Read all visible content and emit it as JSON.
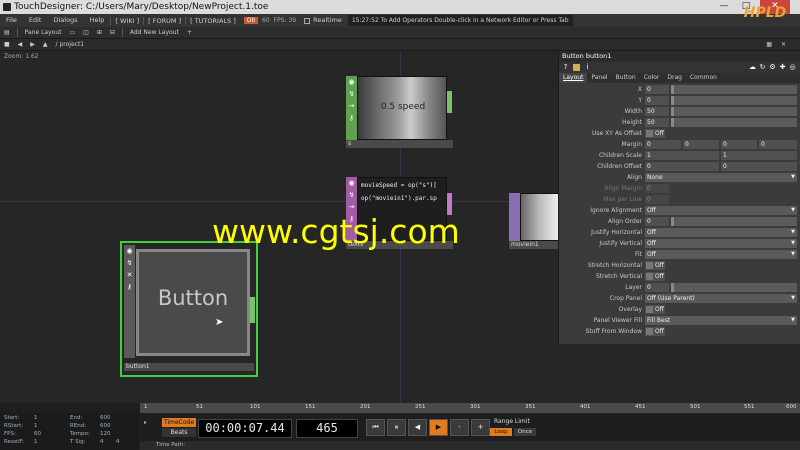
{
  "window": {
    "title": "TouchDesigner: C:/Users/Mary/Desktop/NewProject.1.toe",
    "minimize": "—",
    "maximize": "□",
    "close": "✕"
  },
  "menu": {
    "items": [
      "File",
      "Edit",
      "Dialogs",
      "Help"
    ],
    "links": [
      "[ WIKI ]",
      "[ FORUM ]",
      "[ TUTORIALS ]"
    ],
    "badge": "OII",
    "fps_label": "60",
    "fps_value": "FPS: 39",
    "realtime_label": "Realtime",
    "status": "15:27:52 To Add Operators Double-click in a Network Editor or Press Tab"
  },
  "toolbar": {
    "pane_layout": "Pane Layout",
    "add_new_layout": "Add New Layout",
    "plus": "+",
    "path": "/ project1"
  },
  "network": {
    "zoom": "Zoom: 1.62",
    "nodes": {
      "speed": {
        "label": "0.5 speed",
        "name": "s"
      },
      "text": {
        "line1": "movieSpeed = op(\"s\")[",
        "line2": "op(\"moviein1\").par.sp",
        "name": "text1"
      },
      "movie": {
        "name": "moviein1"
      },
      "button": {
        "label": "Button",
        "name": "button1"
      }
    }
  },
  "watermark": "www.cgtsj.com",
  "logo": "HPLD",
  "params": {
    "header": "Button   button1",
    "icons": [
      "?",
      "i"
    ],
    "tabs": [
      "Layout",
      "Panel",
      "Button",
      "Color",
      "Drag",
      "Common"
    ],
    "rows": [
      {
        "label": "X",
        "value": "0"
      },
      {
        "label": "Y",
        "value": "0"
      },
      {
        "label": "Width",
        "value": "50"
      },
      {
        "label": "Height",
        "value": "50"
      },
      {
        "label": "Use XY As Offset",
        "toggle": "Off"
      },
      {
        "label": "Margin",
        "values": [
          "0",
          "0",
          "0",
          "0"
        ]
      },
      {
        "label": "Children Scale",
        "values": [
          "1",
          "1"
        ]
      },
      {
        "label": "Children Offset",
        "values": [
          "0",
          "0"
        ]
      },
      {
        "label": "Align",
        "menu": "None"
      },
      {
        "label": "Align Margin",
        "value": "0"
      },
      {
        "label": "Max per Line",
        "value": "0"
      },
      {
        "label": "Ignore Alignment",
        "menu": "Off"
      },
      {
        "label": "Align Order",
        "value": "0"
      },
      {
        "label": "Justify Horizontal",
        "menu": "Off"
      },
      {
        "label": "Justify Vertical",
        "menu": "Off"
      },
      {
        "label": "Fit",
        "menu": "Off"
      },
      {
        "label": "Stretch Horizontal",
        "toggle": "Off"
      },
      {
        "label": "Stretch Vertical",
        "toggle": "Off"
      },
      {
        "label": "Layer",
        "value": "0"
      },
      {
        "label": "Crop Panel",
        "menu": "Off (Use Parent)"
      },
      {
        "label": "Overlay",
        "toggle": "Off"
      },
      {
        "label": "Panel Viewer Fill",
        "menu": "Fill Best"
      },
      {
        "label": "Stuff From Window",
        "toggle": "Off"
      }
    ]
  },
  "timeline": {
    "ticks": [
      "1",
      "51",
      "101",
      "151",
      "201",
      "251",
      "301",
      "351",
      "401",
      "451",
      "501",
      "551",
      "600"
    ],
    "stats": {
      "start_label": "Start:",
      "start": "1",
      "end_label": "End:",
      "end": "600",
      "rstart_label": "RStart:",
      "rstart": "1",
      "rend_label": "REnd:",
      "rend": "600",
      "fps_label": "FPS:",
      "fps": "60",
      "tempo_label": "Tempo:",
      "tempo": "120",
      "reset_label": "ResetF:",
      "reset": "1",
      "tsig_label": "T Sig:",
      "tsig_a": "4",
      "tsig_b": "4"
    },
    "timecode_tab": "TimeCode",
    "beats_tab": "Beats",
    "timecode": "00:00:07.44",
    "frame": "465",
    "transport": [
      "⏮",
      "⏸",
      "◀",
      "▶",
      "-",
      "+"
    ],
    "range_limit": "Range Limit",
    "loop": "Loop",
    "once": "Once",
    "time_path": "Time Path:",
    "colors": {
      "accent": "#e07b20"
    }
  }
}
